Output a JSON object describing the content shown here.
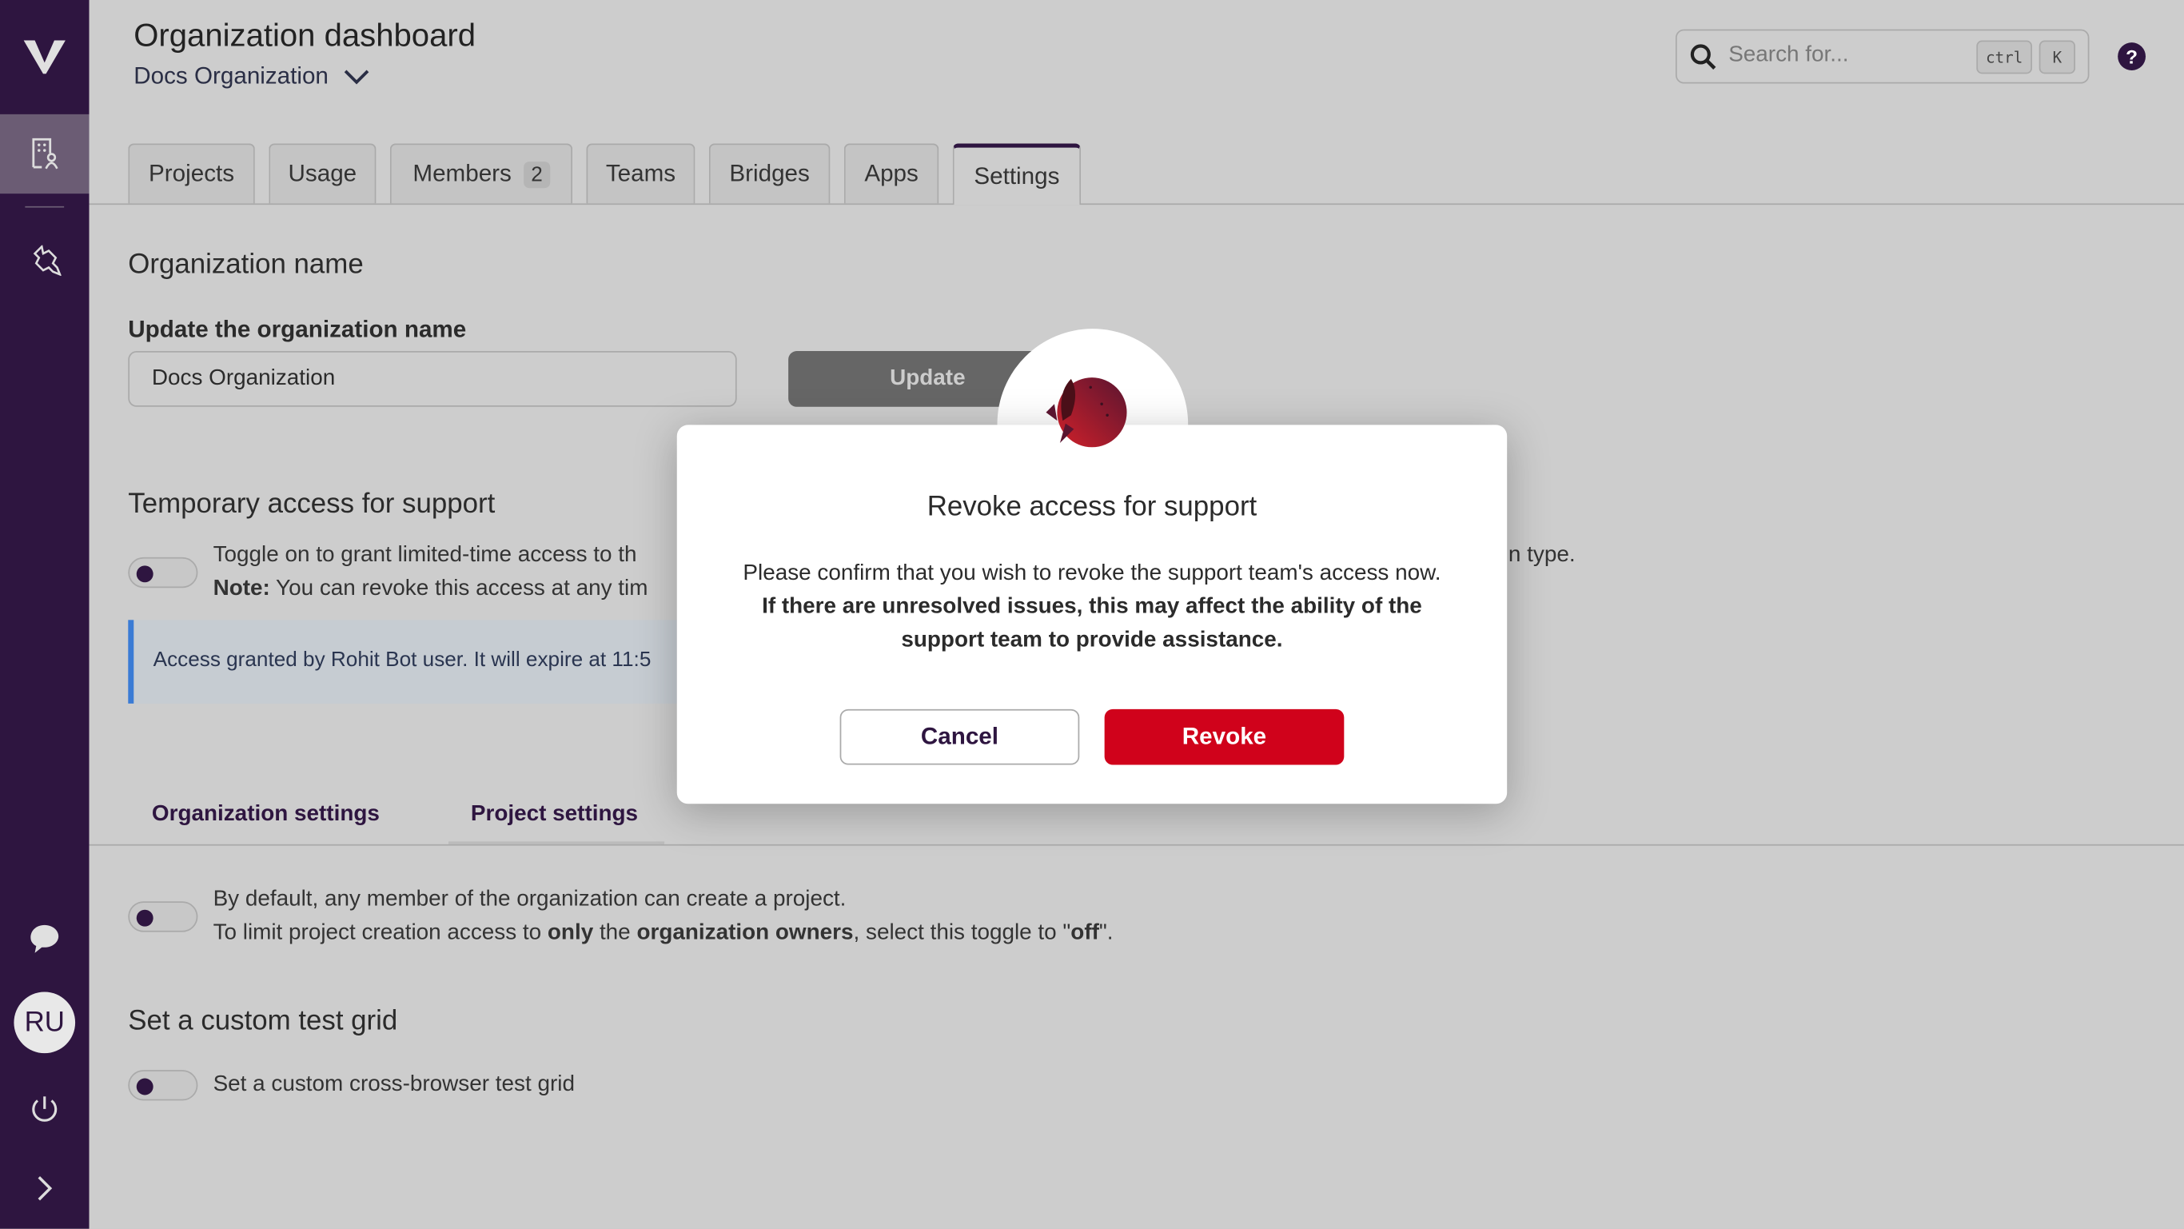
{
  "header": {
    "title": "Organization dashboard",
    "org_selector": "Docs Organization"
  },
  "search": {
    "placeholder": "Search for...",
    "shortcut_ctrl": "ctrl",
    "shortcut_key": "K"
  },
  "sidebar": {
    "avatar_initials": "RU"
  },
  "tabs": [
    {
      "label": "Projects"
    },
    {
      "label": "Usage"
    },
    {
      "label": "Members",
      "badge": "2"
    },
    {
      "label": "Teams"
    },
    {
      "label": "Bridges"
    },
    {
      "label": "Apps"
    },
    {
      "label": "Settings",
      "active": true
    }
  ],
  "org_name": {
    "heading": "Organization name",
    "label": "Update the organization name",
    "value": "Docs Organization",
    "update_button": "Update"
  },
  "support": {
    "heading": "Temporary access for support",
    "line1": "Toggle on to grant limited-time access to th",
    "line1_tail": "n type.",
    "note_label": "Note:",
    "line2": " You can revoke this access at any tim",
    "info": "Access granted by Rohit Bot user. It will expire at 11:5"
  },
  "subtabs": [
    {
      "label": "Organization settings"
    },
    {
      "label": "Project settings"
    }
  ],
  "project_creation": {
    "line1": "By default, any member of the organization can create a project.",
    "l2a": "To limit project creation access to ",
    "l2b": "only",
    "l2c": " the ",
    "l2d": "organization owners",
    "l2e": ", select this toggle to \"",
    "l2f": "off",
    "l2g": "\"."
  },
  "test_grid": {
    "heading": "Set a custom test grid",
    "label": "Set a custom cross-browser test grid"
  },
  "modal": {
    "title": "Revoke access for support",
    "body": "Please confirm that you wish to revoke the support team's access now.",
    "warning": "If there are unresolved issues, this may affect the ability of the support team to provide assistance.",
    "cancel": "Cancel",
    "revoke": "Revoke"
  },
  "colors": {
    "brand": "#2e1540",
    "danger": "#d0021b",
    "info_border": "#3a7bd5"
  }
}
